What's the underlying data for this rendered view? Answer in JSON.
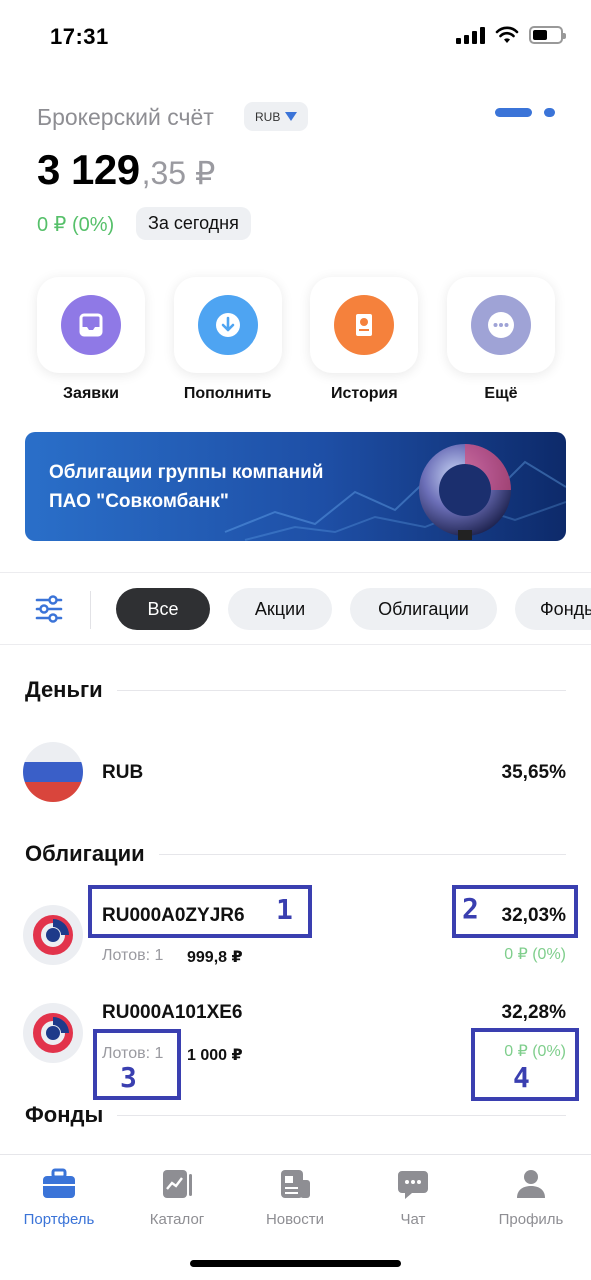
{
  "status_bar": {
    "time": "17:31"
  },
  "header": {
    "account_title": "Брокерский счёт",
    "currency": "RUB",
    "balance_main": "3 129",
    "balance_fraction": ",35 ₽",
    "day_change": "0 ₽ (0%)",
    "period": "За сегодня"
  },
  "actions": [
    {
      "label": "Заявки",
      "icon": "tray-icon",
      "color": "#8f79e6"
    },
    {
      "label": "Пополнить",
      "icon": "download-arrow-icon",
      "color": "#4ea4f2"
    },
    {
      "label": "История",
      "icon": "document-clock-icon",
      "color": "#f5813c"
    },
    {
      "label": "Ещё",
      "icon": "more-dots-icon",
      "color": "#9fa3d6"
    }
  ],
  "banner": {
    "line1": "Облигации группы компаний",
    "line2": "ПАО \"Совкомбанк\""
  },
  "filters": [
    "Все",
    "Акции",
    "Облигации",
    "Фонды"
  ],
  "sections": {
    "money": {
      "title": "Деньги",
      "items": [
        {
          "name": "RUB",
          "percent": "35,65%"
        }
      ]
    },
    "bonds": {
      "title": "Облигации",
      "items": [
        {
          "name": "RU000A0ZYJR6",
          "percent": "32,03%",
          "lots": "Лотов: 1",
          "price": "999,8 ₽",
          "change": "0 ₽ (0%)"
        },
        {
          "name": "RU000A101XE6",
          "percent": "32,28%",
          "lots": "Лотов: 1",
          "price": "1 000 ₽",
          "change": "0 ₽ (0%)"
        }
      ]
    },
    "funds": {
      "title": "Фонды"
    }
  },
  "annotations": [
    "1",
    "2",
    "3",
    "4"
  ],
  "nav": [
    {
      "label": "Портфель",
      "icon": "briefcase-icon",
      "active": true
    },
    {
      "label": "Каталог",
      "icon": "chart-card-icon",
      "active": false
    },
    {
      "label": "Новости",
      "icon": "newspaper-icon",
      "active": false
    },
    {
      "label": "Чат",
      "icon": "chat-bubble-icon",
      "active": false
    },
    {
      "label": "Профиль",
      "icon": "profile-icon",
      "active": false
    }
  ],
  "colors": {
    "accent": "#3b74d8",
    "positive": "#56c06a",
    "annotation": "#3a3fb0"
  }
}
